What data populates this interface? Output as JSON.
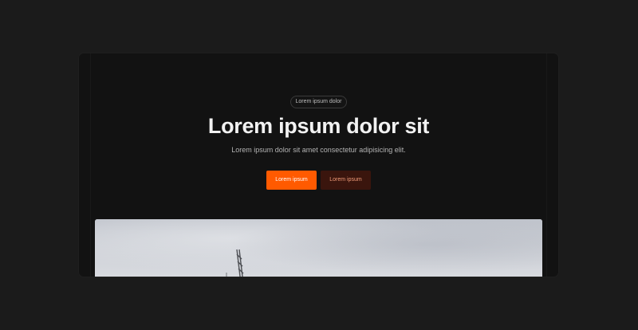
{
  "hero": {
    "badge": "Lorem ipsum dolor",
    "title": "Lorem ipsum dolor sit",
    "subtitle": "Lorem ipsum dolor sit amet consectetur adipisicing elit.",
    "primary_button": "Lorem ipsum",
    "secondary_button": "Lorem ipsum"
  },
  "colors": {
    "page_background": "#1b1b1b",
    "card_background": "#121212",
    "accent": "#ff5a00",
    "secondary_button_background": "#3a150d",
    "secondary_button_text": "#f09a78"
  },
  "image": {
    "subject": "cloudy sky with crane"
  }
}
